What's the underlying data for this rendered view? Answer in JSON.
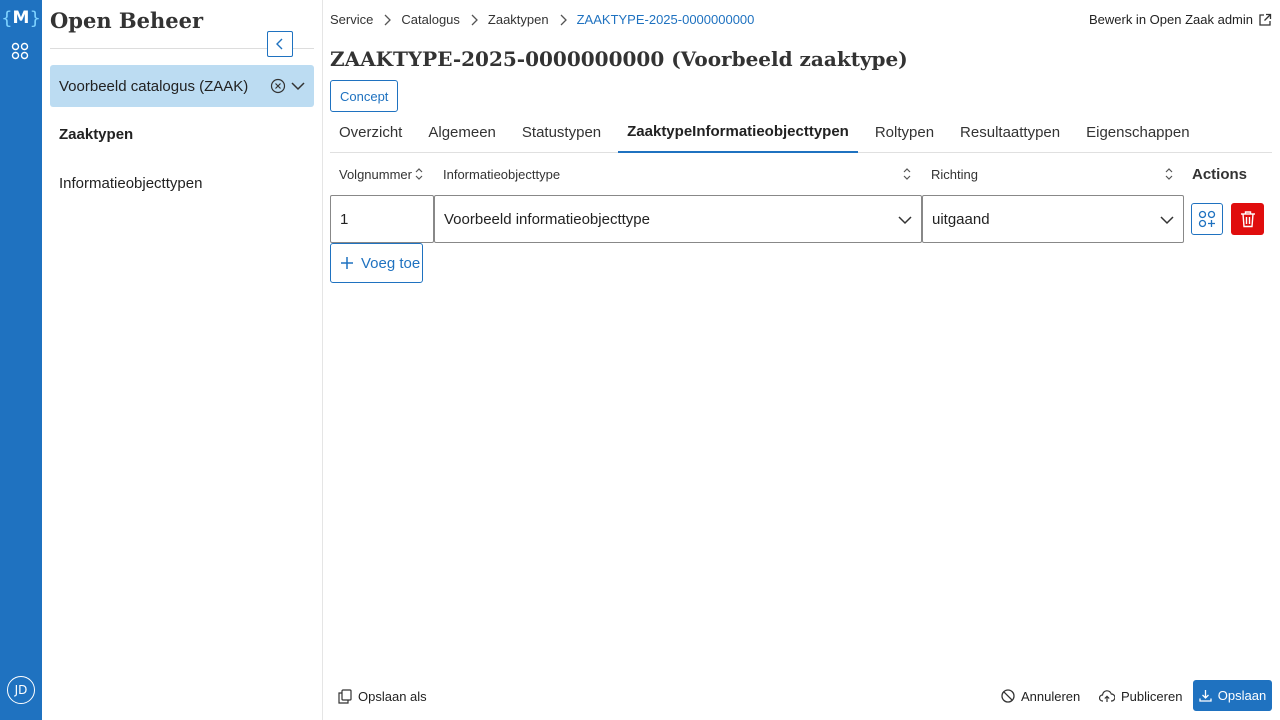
{
  "rail": {
    "logo_text": "M",
    "logo_brace_left": "{",
    "logo_brace_right": "}",
    "avatar_initials": "JD"
  },
  "sidebar": {
    "app_title": "Open Beheer",
    "catalog_selected": "Voorbeeld catalogus (ZAAK)",
    "items": [
      {
        "label": "Zaaktypen",
        "active": true
      },
      {
        "label": "Informatieobjecttypen",
        "active": false
      }
    ]
  },
  "breadcrumb": {
    "items": [
      "Service",
      "Catalogus",
      "Zaaktypen"
    ],
    "current": "ZAAKTYPE-2025-0000000000"
  },
  "admin_link": "Bewerk in Open Zaak admin",
  "page_title": "ZAAKTYPE-2025-0000000000 (Voorbeeld zaaktype)",
  "status_badge": "Concept",
  "tabs": [
    {
      "label": "Overzicht",
      "active": false
    },
    {
      "label": "Algemeen",
      "active": false
    },
    {
      "label": "Statustypen",
      "active": false
    },
    {
      "label": "ZaaktypeInformatieobjecttypen",
      "active": true
    },
    {
      "label": "Roltypen",
      "active": false
    },
    {
      "label": "Resultaattypen",
      "active": false
    },
    {
      "label": "Eigenschappen",
      "active": false
    }
  ],
  "table": {
    "headers": {
      "volgnummer": "Volgnummer",
      "informatieobjecttype": "Informatieobjecttype",
      "richting": "Richting",
      "actions": "Actions"
    },
    "rows": [
      {
        "volgnummer": "1",
        "informatieobjecttype": "Voorbeeld informatieobjecttype",
        "richting": "uitgaand"
      }
    ],
    "add_label": "Voeg toe"
  },
  "footer": {
    "save_as": "Opslaan als",
    "cancel": "Annuleren",
    "publish": "Publiceren",
    "save": "Opslaan"
  },
  "colors": {
    "brand": "#1f72c0",
    "danger": "#e00d0d",
    "catalog_bg": "#bcdcf2"
  }
}
